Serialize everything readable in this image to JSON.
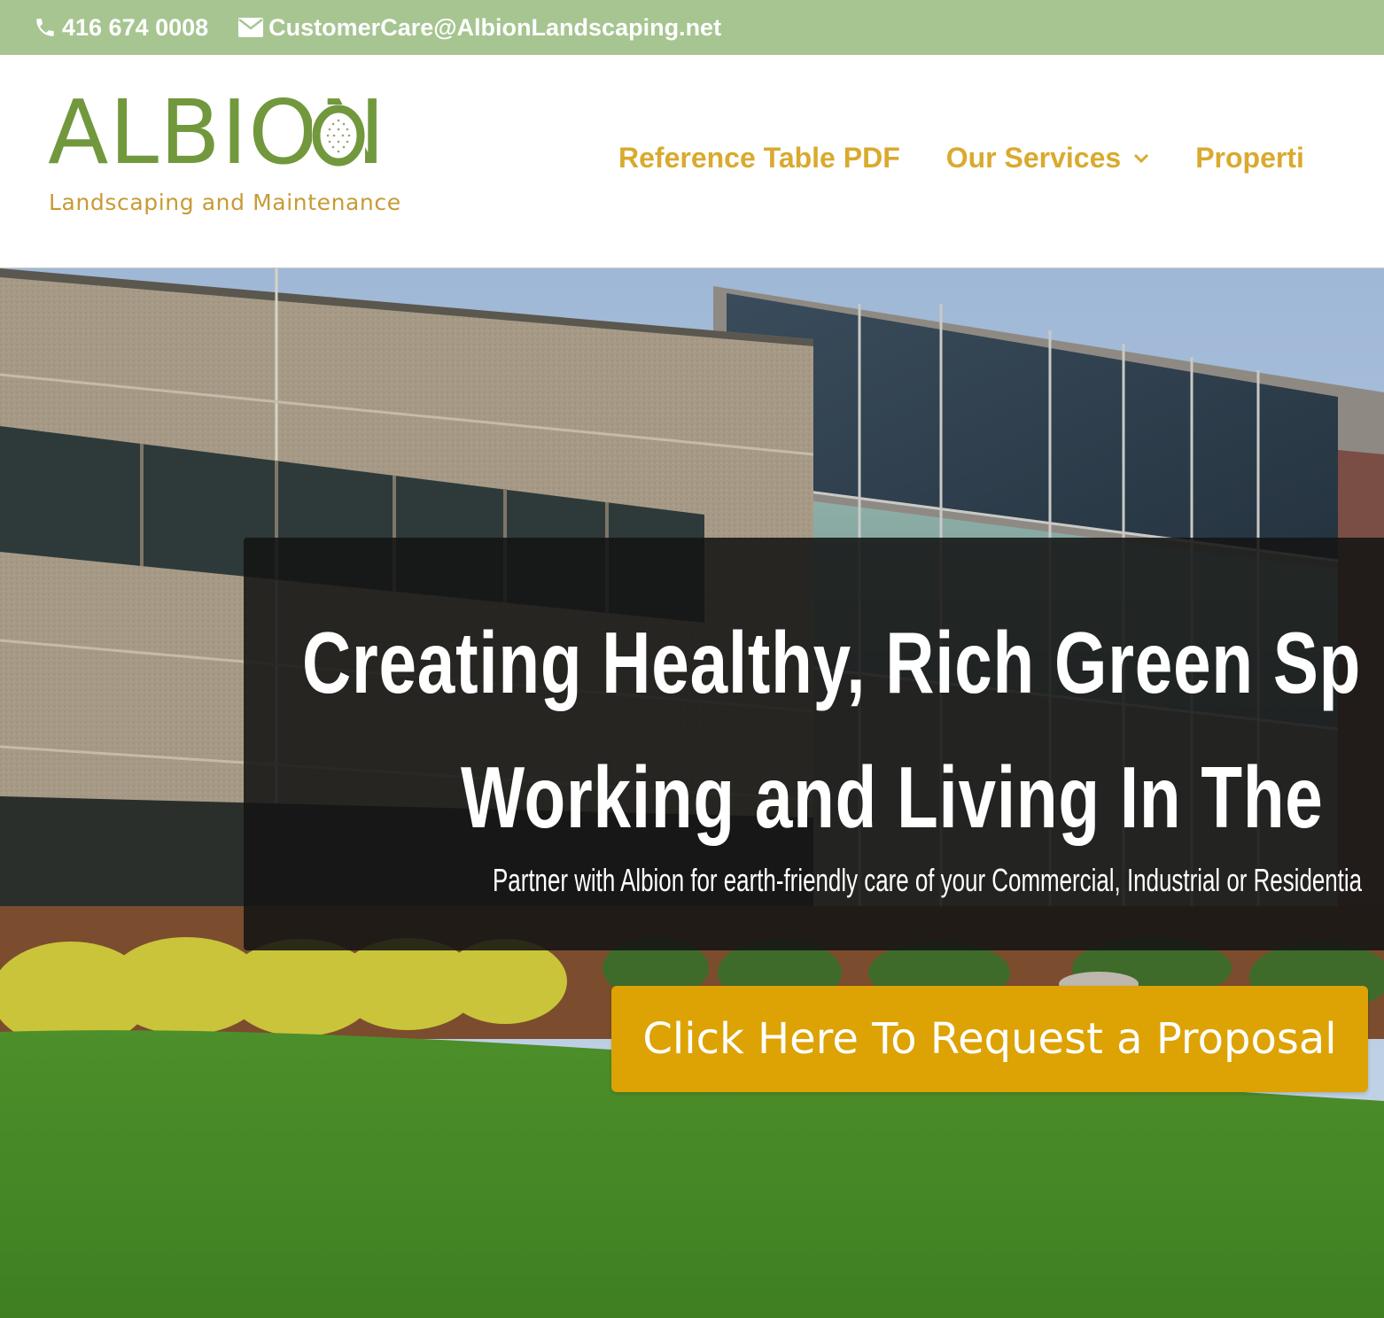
{
  "topbar": {
    "phone_icon": "phone-icon",
    "phone": "416 674 0008",
    "email_icon": "envelope-icon",
    "email": "CustomerCare@AlbionLandscaping.net"
  },
  "logo": {
    "name": "ALBION",
    "tagline": "Landscaping and Maintenance"
  },
  "nav": {
    "items": [
      {
        "label": "Reference Table PDF"
      },
      {
        "label": "Our Services",
        "has_dropdown": true,
        "icon": "chevron-down-icon"
      },
      {
        "label": "Properti"
      }
    ]
  },
  "hero": {
    "headline_line1": "Creating Healthy, Rich Green Sp",
    "headline_line2": "Working and Living In The",
    "subtext": "Partner with Albion for earth-friendly care of your Commercial, Industrial or Residentia",
    "cta_label": "Click Here To Request a Proposal"
  },
  "colors": {
    "topbar_bg": "#a6c591",
    "logo_green": "#72983d",
    "logo_gold": "#c79b34",
    "nav_gold": "#d9aa2e",
    "cta_bg": "#dda204",
    "caption_bg": "#141414"
  }
}
